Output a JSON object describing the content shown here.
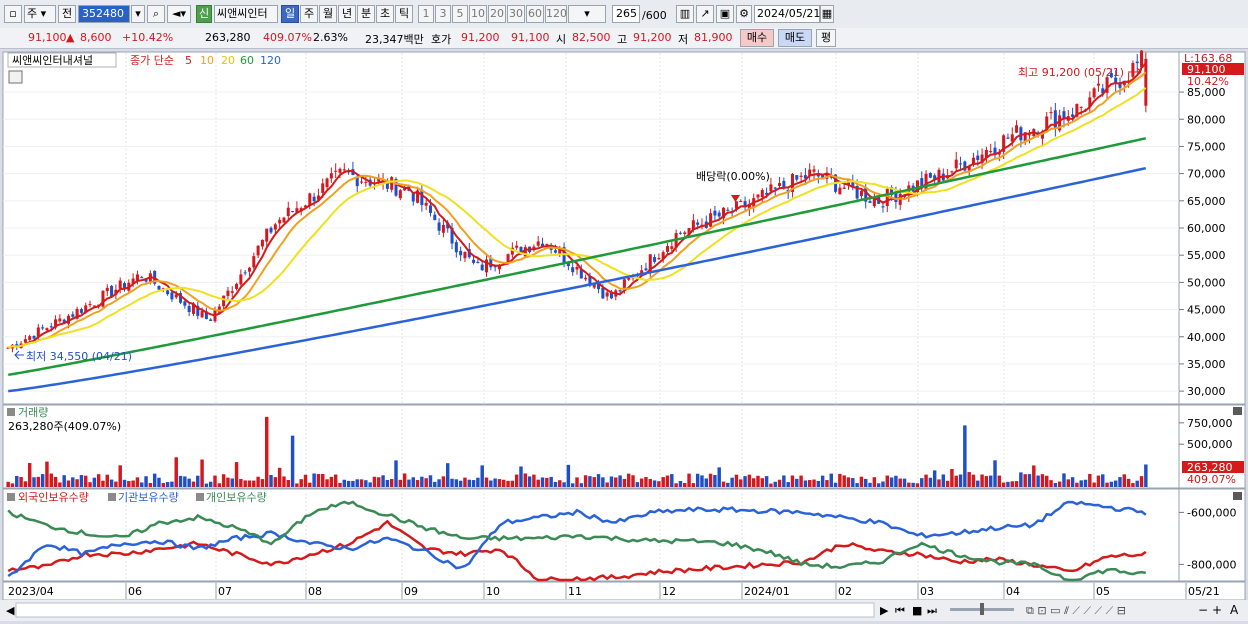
{
  "toolbar": {
    "market": "주",
    "prev_label": "전",
    "code": "352480",
    "new_badge": "신",
    "stock_name": "씨앤씨인터",
    "periods": [
      "일",
      "주",
      "월",
      "년",
      "분",
      "초",
      "틱"
    ],
    "selected_period": "일",
    "intervals": [
      "1",
      "3",
      "5",
      "10",
      "20",
      "30",
      "60",
      "120"
    ],
    "count": "265",
    "count_total": "/600",
    "date": "2024/05/21"
  },
  "quote": {
    "price": "91,100",
    "change": "8,600",
    "change_pct": "+10.42%",
    "volume": "263,280",
    "volume_pct": "409.07%",
    "turnover": "2.63%",
    "amount": "23,347백만",
    "bid_label": "호가",
    "bid1": "91,200",
    "bid2": "91,100",
    "open_label": "시",
    "open": "82,500",
    "high_label": "고",
    "high": "91,200",
    "low_label": "저",
    "low": "81,900",
    "buy": "매수",
    "sell": "매도",
    "eval": "평"
  },
  "price_panel": {
    "name": "씨앤씨인터내셔널",
    "legend_prefix": "종가 단순",
    "ma": [
      {
        "period": "5",
        "color": "#d41a1a"
      },
      {
        "period": "10",
        "color": "#f0a020"
      },
      {
        "period": "20",
        "color": "#f0e020"
      },
      {
        "period": "60",
        "color": "#1e9a3a"
      },
      {
        "period": "120",
        "color": "#2a63d8"
      }
    ],
    "high_annot": "최고 91,200 (05/21)",
    "low_annot": "최저 34,550 (04/21)",
    "dividend_annot": "배당락(0.00%)",
    "top_label": "L:163.68",
    "last_price_tag": "91,100",
    "last_pct_tag": "10.42%",
    "y_ticks": [
      "85,000",
      "80,000",
      "75,000",
      "70,000",
      "65,000",
      "60,000",
      "55,000",
      "50,000",
      "45,000",
      "40,000",
      "35,000",
      "30,000"
    ]
  },
  "volume_panel": {
    "title": "거래량",
    "value_line": "263,280주(409.07%)",
    "y_ticks": [
      "750,000",
      "500,000"
    ],
    "tag_value": "263,280",
    "tag_pct": "409.07%"
  },
  "holding_panel": {
    "series": [
      {
        "name": "외국인보유수량",
        "color": "#d41a1a"
      },
      {
        "name": "기관보유수량",
        "color": "#2a63d8"
      },
      {
        "name": "개인보유수량",
        "color": "#3a8a55"
      }
    ],
    "y_ticks": [
      "-600,000",
      "-800,000"
    ]
  },
  "x_axis": [
    "2023/04",
    "06",
    "07",
    "08",
    "09",
    "10",
    "11",
    "12",
    "2024/01",
    "02",
    "03",
    "04",
    "05",
    "05/21"
  ],
  "colors": {
    "up": "#d4181f",
    "down": "#1f4fc8",
    "background": "#ffffff"
  },
  "chart_data": {
    "type": "candlestick",
    "title": "씨앤씨인터내셔널",
    "x_range": [
      "2023/04",
      "2024/05/21"
    ],
    "ylim": [
      28000,
      92000
    ],
    "price_keypoints": [
      {
        "date": "2023/04",
        "close": 38000
      },
      {
        "date": "04/21",
        "low": 34550
      },
      {
        "date": "06",
        "close": 44500
      },
      {
        "date": "07",
        "close": 51500
      },
      {
        "date": "07 mid",
        "close": 43000
      },
      {
        "date": "08 mid",
        "close": 61000
      },
      {
        "date": "08 end",
        "close": 70000
      },
      {
        "date": "09 end",
        "close": 67000
      },
      {
        "date": "10",
        "close": 52500
      },
      {
        "date": "11",
        "close": 58000
      },
      {
        "date": "11 mid",
        "close": 47000
      },
      {
        "date": "12",
        "close": 59000
      },
      {
        "date": "12 end",
        "close": 64000
      },
      {
        "date": "2024/01",
        "close": 70000
      },
      {
        "date": "02",
        "close": 65000
      },
      {
        "date": "03",
        "close": 70000
      },
      {
        "date": "04",
        "close": 77000
      },
      {
        "date": "05",
        "close": 82000
      },
      {
        "date": "05/21",
        "close": 91100
      }
    ],
    "ma120_range": [
      30000,
      71000
    ],
    "ma60_range": [
      33000,
      76500
    ],
    "volume_peaks": [
      {
        "date": "08",
        "volume": 820000
      },
      {
        "date": "03",
        "volume": 720000
      },
      {
        "date": "05/21",
        "volume": 263280
      }
    ],
    "holdings_range": [
      -860000,
      -560000
    ]
  }
}
